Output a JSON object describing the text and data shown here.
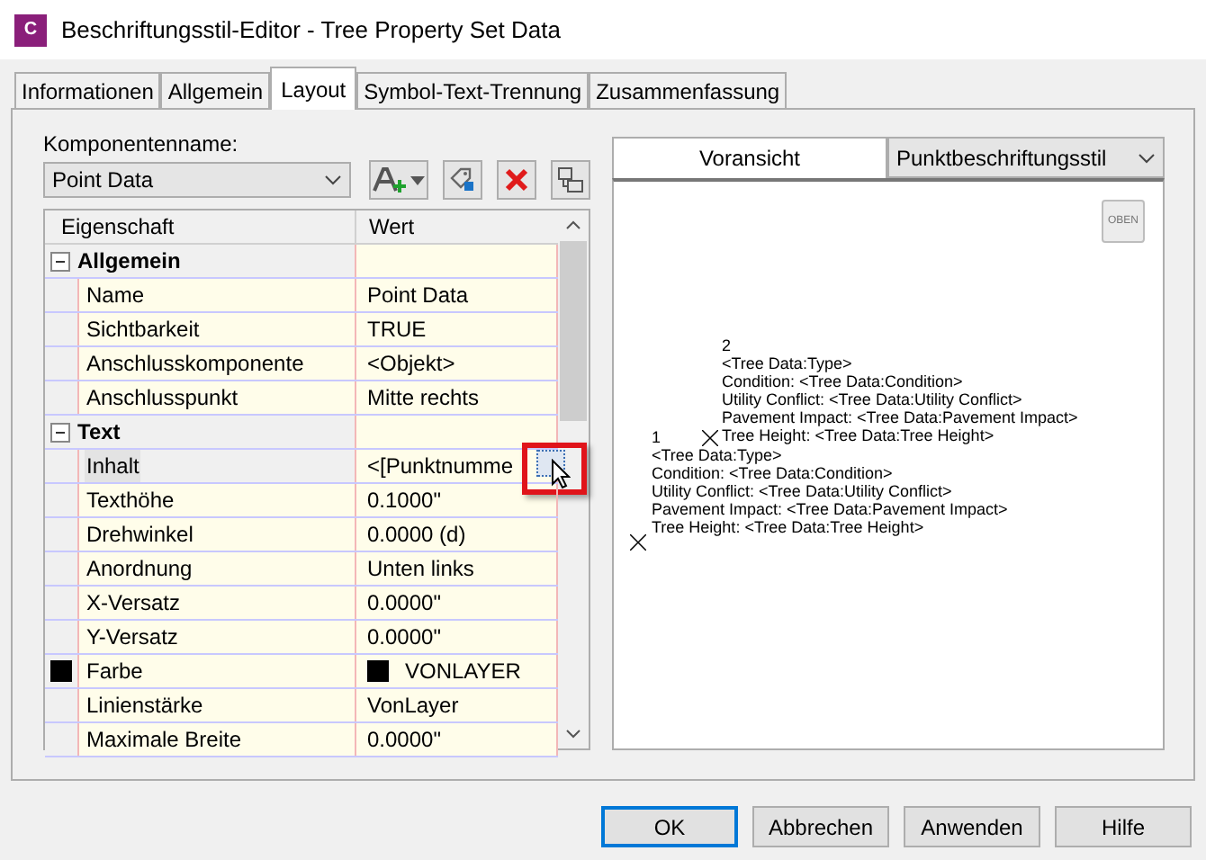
{
  "window": {
    "title": "Beschriftungsstil-Editor - Tree Property Set Data",
    "app_icon": "C"
  },
  "tabs": [
    {
      "label": "Informationen",
      "selected": false
    },
    {
      "label": "Allgemein",
      "selected": false
    },
    {
      "label": "Layout",
      "selected": true
    },
    {
      "label": "Symbol-Text-Trennung",
      "selected": false
    },
    {
      "label": "Zusammenfassung",
      "selected": false
    }
  ],
  "component": {
    "label": "Komponentenname:",
    "value": "Point Data"
  },
  "property_grid": {
    "columns": [
      "Eigenschaft",
      "Wert"
    ],
    "groups": [
      {
        "title": "Allgemein",
        "expanded": true,
        "rows": [
          {
            "name": "Name",
            "value": "Point Data",
            "selected": false
          },
          {
            "name": "Sichtbarkeit",
            "value": "TRUE",
            "selected": false
          },
          {
            "name": "Anschlusskomponente",
            "value": "<Objekt>",
            "selected": false
          },
          {
            "name": "Anschlusspunkt",
            "value": "Mitte rechts",
            "selected": false
          }
        ]
      },
      {
        "title": "Text",
        "expanded": true,
        "rows": [
          {
            "name": "Inhalt",
            "value": "<[Punktnumme",
            "selected": true,
            "has_ellipsis_button": true
          },
          {
            "name": "Texthöhe",
            "value": "0.1000\"",
            "selected": false
          },
          {
            "name": "Drehwinkel",
            "value": "0.0000 (d)",
            "selected": false
          },
          {
            "name": "Anordnung",
            "value": "Unten links",
            "selected": false
          },
          {
            "name": "X-Versatz",
            "value": "0.0000\"",
            "selected": false
          },
          {
            "name": "Y-Versatz",
            "value": "0.0000\"",
            "selected": false
          },
          {
            "name": "Farbe",
            "value": "VONLAYER",
            "selected": false,
            "color": "#000000"
          },
          {
            "name": "Linienstärke",
            "value": "VonLayer",
            "selected": false
          },
          {
            "name": "Maximale Breite",
            "value": "0.0000\"",
            "selected": false
          }
        ]
      }
    ]
  },
  "preview": {
    "tab": "Voransicht",
    "style_dropdown": "Punktbeschriftungsstil",
    "view_button": "OBEN",
    "labels": [
      {
        "number": "2",
        "lines": [
          "<Tree Data:Type>",
          "Condition: <Tree Data:Condition>",
          "Utility Conflict: <Tree Data:Utility Conflict>",
          "Pavement Impact: <Tree Data:Pavement Impact>",
          "Tree Height: <Tree Data:Tree Height>"
        ]
      },
      {
        "number": "1",
        "lines": [
          "<Tree Data:Type>",
          "Condition: <Tree Data:Condition>",
          "Utility Conflict: <Tree Data:Utility Conflict>",
          "Pavement Impact: <Tree Data:Pavement Impact>",
          "Tree Height: <Tree Data:Tree Height>"
        ]
      }
    ]
  },
  "buttons": [
    {
      "label": "OK",
      "default": true
    },
    {
      "label": "Abbrechen",
      "default": false
    },
    {
      "label": "Anwenden",
      "default": false
    },
    {
      "label": "Hilfe",
      "default": false
    }
  ]
}
